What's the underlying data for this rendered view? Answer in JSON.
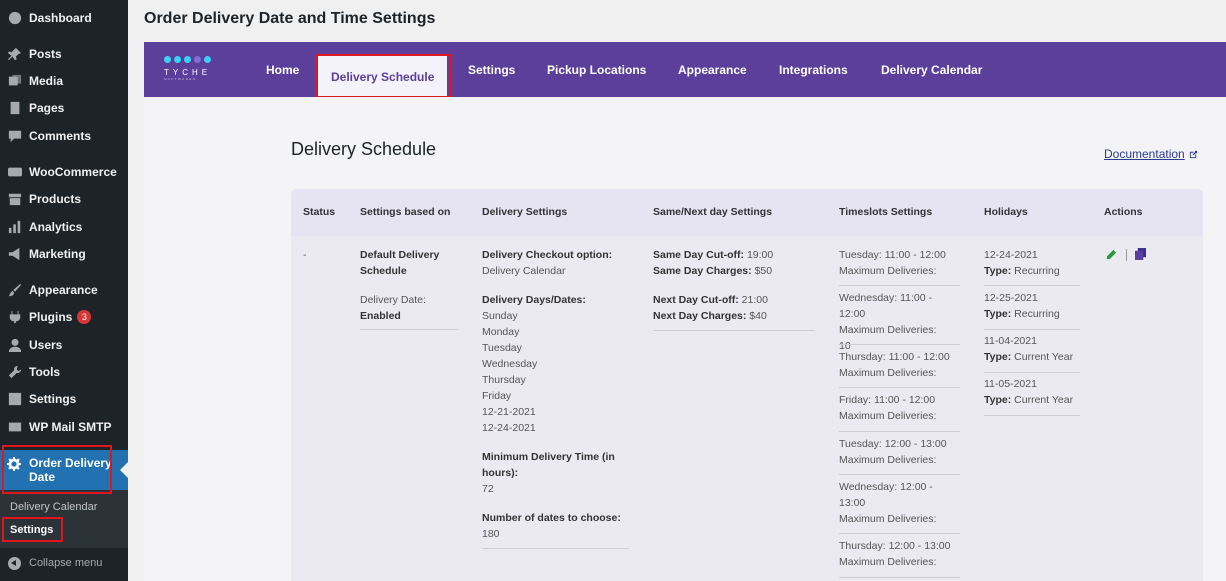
{
  "page_title": "Order Delivery Date and Time Settings",
  "sidebar": {
    "items": [
      {
        "label": "Dashboard",
        "icon": "dashboard-icon"
      },
      {
        "label": "Posts",
        "icon": "pin-icon"
      },
      {
        "label": "Media",
        "icon": "media-icon"
      },
      {
        "label": "Pages",
        "icon": "pages-icon"
      },
      {
        "label": "Comments",
        "icon": "comment-icon"
      },
      {
        "label": "WooCommerce",
        "icon": "woocommerce-icon"
      },
      {
        "label": "Products",
        "icon": "archive-icon"
      },
      {
        "label": "Analytics",
        "icon": "bar-chart-icon"
      },
      {
        "label": "Marketing",
        "icon": "megaphone-icon"
      },
      {
        "label": "Appearance",
        "icon": "brush-icon"
      },
      {
        "label": "Plugins",
        "icon": "plugin-icon",
        "badge": "3"
      },
      {
        "label": "Users",
        "icon": "user-icon"
      },
      {
        "label": "Tools",
        "icon": "wrench-icon"
      },
      {
        "label": "Settings",
        "icon": "settings-icon"
      },
      {
        "label": "WP Mail SMTP",
        "icon": "mail-icon"
      }
    ],
    "active": {
      "label": "Order Delivery Date",
      "icon": "gear-icon"
    },
    "submenu": [
      "Delivery Calendar",
      "Settings"
    ],
    "collapse_label": "Collapse menu"
  },
  "topnav": {
    "logo_text": "TYCHE",
    "logo_sub": "SOFTWARES",
    "tabs": [
      "Home",
      "Delivery Schedule",
      "Settings",
      "Pickup Locations",
      "Appearance",
      "Integrations",
      "Delivery Calendar"
    ],
    "active_tab": "Delivery Schedule"
  },
  "section_title": "Delivery Schedule",
  "documentation_link": "Documentation",
  "table": {
    "headers": [
      "Status",
      "Settings based on",
      "Delivery Settings",
      "Same/Next day Settings",
      "Timeslots Settings",
      "Holidays",
      "Actions"
    ],
    "row": {
      "status": "-",
      "settings_based_on": {
        "title": "Default Delivery Schedule",
        "delivery_date_label": "Delivery Date:",
        "delivery_date_value": "Enabled"
      },
      "delivery_settings": {
        "checkout_label": "Delivery Checkout option:",
        "checkout_value": "Delivery Calendar",
        "days_label": "Delivery Days/Dates:",
        "days": [
          "Sunday",
          "Monday",
          "Tuesday",
          "Wednesday",
          "Thursday",
          "Friday",
          "12-21-2021",
          "12-24-2021"
        ],
        "min_time_label": "Minimum Delivery Time (in hours):",
        "min_time_value": "72",
        "num_dates_label": "Number of dates to choose:",
        "num_dates_value": "180"
      },
      "same_next_day": {
        "same_cutoff_label": "Same Day Cut-off:",
        "same_cutoff_value": "19:00",
        "same_charges_label": "Same Day Charges:",
        "same_charges_value": "$50",
        "next_cutoff_label": "Next Day Cut-off:",
        "next_cutoff_value": "21:00",
        "next_charges_label": "Next Day Charges:",
        "next_charges_value": "$40"
      },
      "timeslots": [
        {
          "slot": "Tuesday: 11:00 - 12:00",
          "max": "Maximum Deliveries:"
        },
        {
          "slot": "Wednesday: 11:00 - 12:00",
          "max": "Maximum Deliveries: 10"
        },
        {
          "slot": "Thursday: 11:00 - 12:00",
          "max": "Maximum Deliveries:"
        },
        {
          "slot": "Friday: 11:00 - 12:00",
          "max": "Maximum Deliveries:"
        },
        {
          "slot": "Tuesday: 12:00 - 13:00",
          "max": "Maximum Deliveries:"
        },
        {
          "slot": "Wednesday: 12:00 - 13:00",
          "max": "Maximum Deliveries:"
        },
        {
          "slot": "Thursday: 12:00 - 13:00",
          "max": "Maximum Deliveries:"
        }
      ],
      "holidays": [
        {
          "date": "12-24-2021",
          "type_label": "Type:",
          "type": "Recurring"
        },
        {
          "date": "12-25-2021",
          "type_label": "Type:",
          "type": "Recurring"
        },
        {
          "date": "11-04-2021",
          "type_label": "Type:",
          "type": "Current Year"
        },
        {
          "date": "11-05-2021",
          "type_label": "Type:",
          "type": "Current Year"
        }
      ],
      "actions": [
        "edit-icon",
        "copy-icon"
      ]
    }
  },
  "colors": {
    "nav_purple": "#5b3f9b",
    "wp_sidebar": "#1d2327",
    "wp_active_blue": "#2271b1",
    "highlight_red": "#e0161e"
  }
}
